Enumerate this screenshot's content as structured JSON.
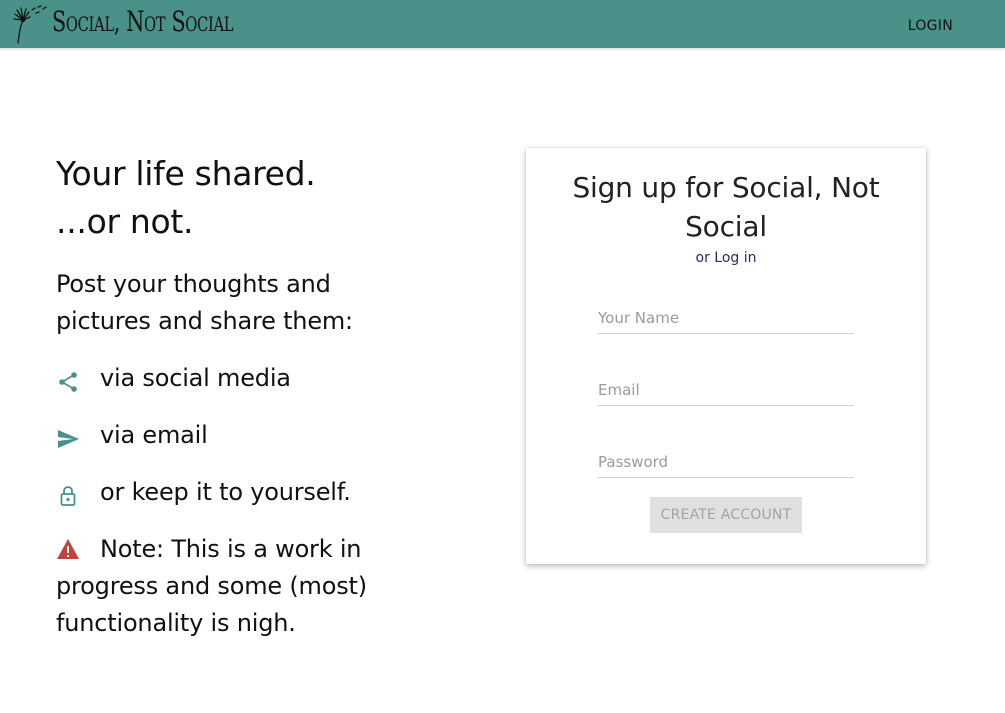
{
  "header": {
    "brand": "Social, Not Social",
    "login_label": "LOGIN",
    "background_color": "#4a9189"
  },
  "hero": {
    "headline_line1": "Your life shared.",
    "headline_line2": "...or not.",
    "intro": "Post your thoughts and pictures and share them:",
    "features": [
      {
        "icon": "share-icon",
        "label": "via social media"
      },
      {
        "icon": "send-icon",
        "label": "via email"
      },
      {
        "icon": "lock-icon",
        "label": "or keep it to yourself."
      }
    ],
    "note_icon": "warning-icon",
    "note": "Note: This is a work in progress and some (most) functionality is nigh."
  },
  "signup": {
    "title": "Sign up for Social, Not Social",
    "alt_login": "or Log in",
    "name_placeholder": "Your Name",
    "email_placeholder": "Email",
    "password_placeholder": "Password",
    "create_label": "CREATE ACCOUNT",
    "create_disabled": true
  },
  "colors": {
    "accent": "#4a9189",
    "link": "#3b1f63",
    "warning": "#c0443b",
    "disabled_button_bg": "#e0e0e0"
  }
}
